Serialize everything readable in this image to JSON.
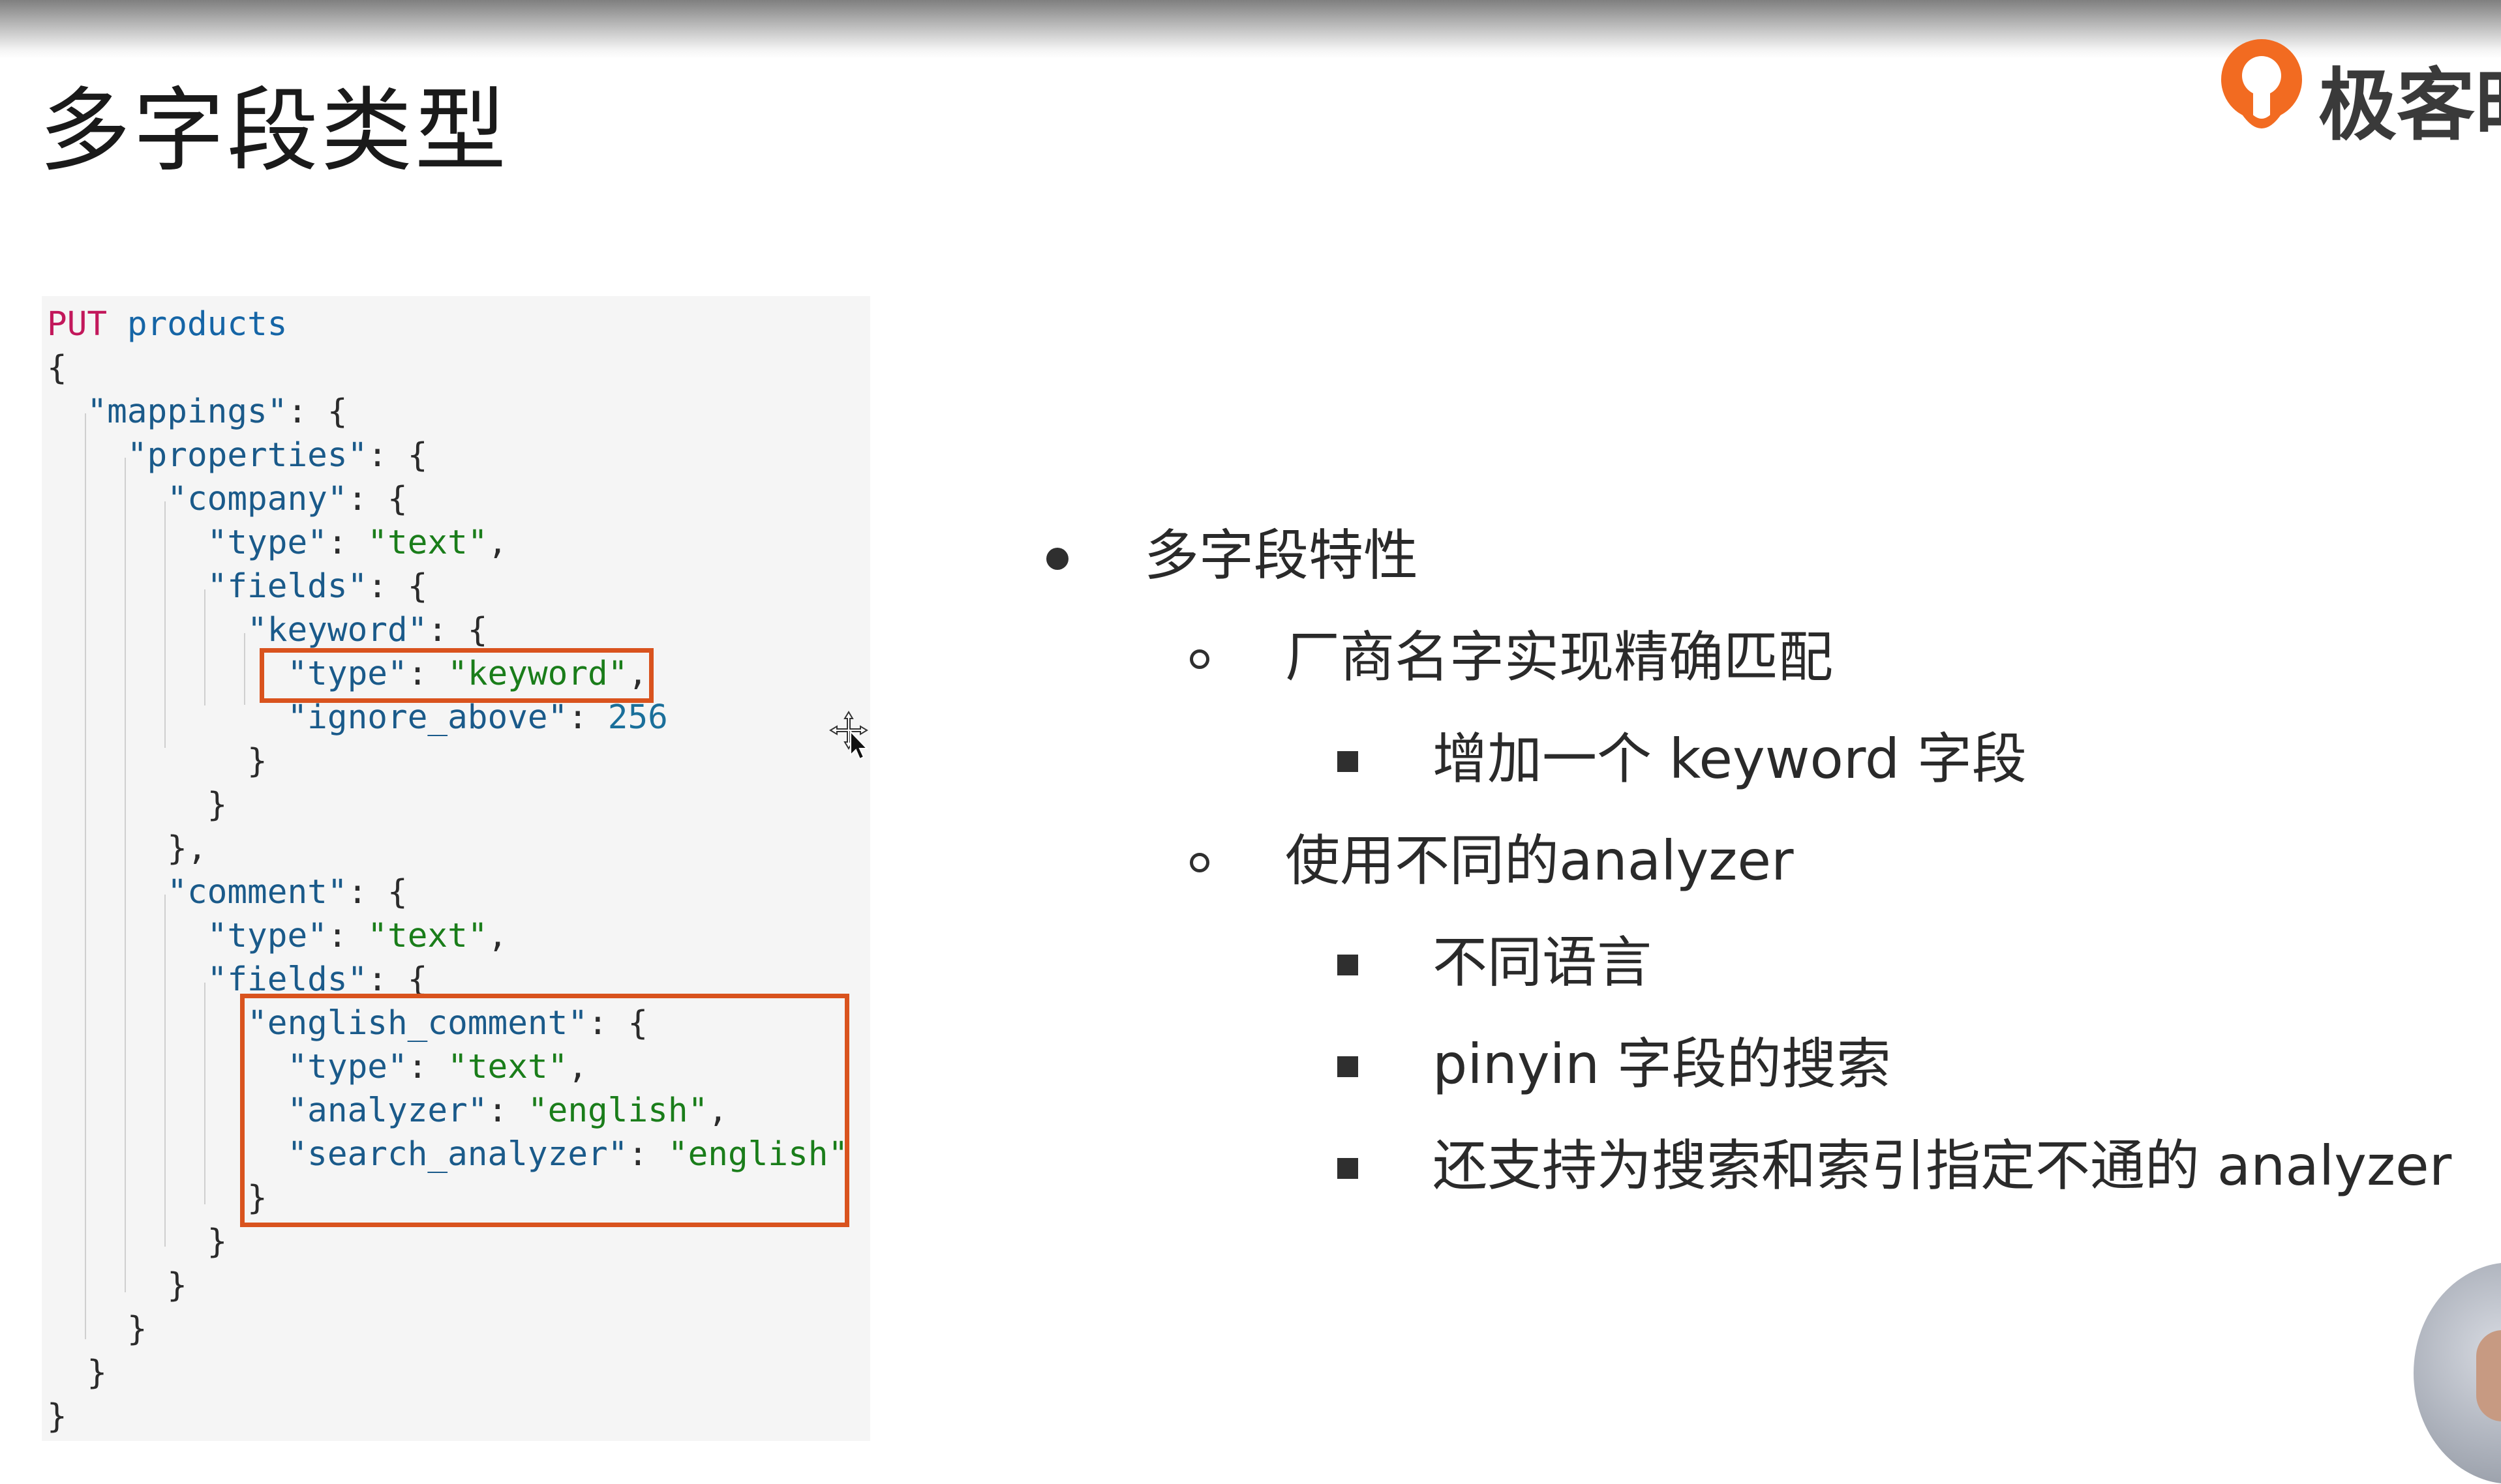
{
  "slide": {
    "title": "多字段类型",
    "logo_text": "极客时间",
    "accent_color": "#d9531e"
  },
  "code_lines": [
    [
      {
        "t": "PUT",
        "c": "kw"
      },
      {
        "t": " ",
        "c": ""
      },
      {
        "t": "products",
        "c": "idx"
      }
    ],
    [
      {
        "t": "{",
        "c": ""
      }
    ],
    [
      {
        "t": "  ",
        "c": ""
      },
      {
        "t": "\"mappings\"",
        "c": "key"
      },
      {
        "t": ": {",
        "c": ""
      }
    ],
    [
      {
        "t": "    ",
        "c": ""
      },
      {
        "t": "\"properties\"",
        "c": "key"
      },
      {
        "t": ": {",
        "c": ""
      }
    ],
    [
      {
        "t": "      ",
        "c": ""
      },
      {
        "t": "\"company\"",
        "c": "key"
      },
      {
        "t": ": {",
        "c": ""
      }
    ],
    [
      {
        "t": "        ",
        "c": ""
      },
      {
        "t": "\"type\"",
        "c": "key"
      },
      {
        "t": ": ",
        "c": ""
      },
      {
        "t": "\"text\"",
        "c": "str"
      },
      {
        "t": ",",
        "c": ""
      }
    ],
    [
      {
        "t": "        ",
        "c": ""
      },
      {
        "t": "\"fields\"",
        "c": "key"
      },
      {
        "t": ": {",
        "c": ""
      }
    ],
    [
      {
        "t": "          ",
        "c": ""
      },
      {
        "t": "\"keyword\"",
        "c": "key"
      },
      {
        "t": ": {",
        "c": ""
      }
    ],
    [
      {
        "t": "            ",
        "c": ""
      },
      {
        "t": "\"type\"",
        "c": "key"
      },
      {
        "t": ": ",
        "c": ""
      },
      {
        "t": "\"keyword\"",
        "c": "str"
      },
      {
        "t": ",",
        "c": ""
      }
    ],
    [
      {
        "t": "            ",
        "c": ""
      },
      {
        "t": "\"ignore_above\"",
        "c": "key"
      },
      {
        "t": ": ",
        "c": ""
      },
      {
        "t": "256",
        "c": "num"
      }
    ],
    [
      {
        "t": "          }",
        "c": ""
      }
    ],
    [
      {
        "t": "        }",
        "c": ""
      }
    ],
    [
      {
        "t": "      },",
        "c": ""
      }
    ],
    [
      {
        "t": "      ",
        "c": ""
      },
      {
        "t": "\"comment\"",
        "c": "key"
      },
      {
        "t": ": {",
        "c": ""
      }
    ],
    [
      {
        "t": "        ",
        "c": ""
      },
      {
        "t": "\"type\"",
        "c": "key"
      },
      {
        "t": ": ",
        "c": ""
      },
      {
        "t": "\"text\"",
        "c": "str"
      },
      {
        "t": ",",
        "c": ""
      }
    ],
    [
      {
        "t": "        ",
        "c": ""
      },
      {
        "t": "\"fields\"",
        "c": "key"
      },
      {
        "t": ": {",
        "c": ""
      }
    ],
    [
      {
        "t": "          ",
        "c": ""
      },
      {
        "t": "\"english_comment\"",
        "c": "key"
      },
      {
        "t": ": {",
        "c": ""
      }
    ],
    [
      {
        "t": "            ",
        "c": ""
      },
      {
        "t": "\"type\"",
        "c": "key"
      },
      {
        "t": ": ",
        "c": ""
      },
      {
        "t": "\"text\"",
        "c": "str"
      },
      {
        "t": ",",
        "c": ""
      }
    ],
    [
      {
        "t": "            ",
        "c": ""
      },
      {
        "t": "\"analyzer\"",
        "c": "key"
      },
      {
        "t": ": ",
        "c": ""
      },
      {
        "t": "\"english\"",
        "c": "str"
      },
      {
        "t": ",",
        "c": ""
      }
    ],
    [
      {
        "t": "            ",
        "c": ""
      },
      {
        "t": "\"search_analyzer\"",
        "c": "key"
      },
      {
        "t": ": ",
        "c": ""
      },
      {
        "t": "\"english\"",
        "c": "str"
      }
    ],
    [
      {
        "t": "          }",
        "c": ""
      }
    ],
    [
      {
        "t": "        }",
        "c": ""
      }
    ],
    [
      {
        "t": "      }",
        "c": ""
      }
    ],
    [
      {
        "t": "    }",
        "c": ""
      }
    ],
    [
      {
        "t": "  }",
        "c": ""
      }
    ],
    [
      {
        "t": "}",
        "c": ""
      }
    ]
  ],
  "bullets": [
    {
      "level": 1,
      "marker": "disc",
      "text": "多字段特性"
    },
    {
      "level": 2,
      "marker": "circle",
      "text": "厂商名字实现精确匹配"
    },
    {
      "level": 3,
      "marker": "square",
      "text": "增加一个 keyword 字段"
    },
    {
      "level": 2,
      "marker": "circle",
      "text": "使用不同的analyzer"
    },
    {
      "level": 3,
      "marker": "square",
      "text": "不同语言"
    },
    {
      "level": 3,
      "marker": "square",
      "text": "pinyin 字段的搜索"
    },
    {
      "level": 3,
      "marker": "square",
      "text": "还支持为搜索和索引指定不通的 analyzer"
    }
  ]
}
